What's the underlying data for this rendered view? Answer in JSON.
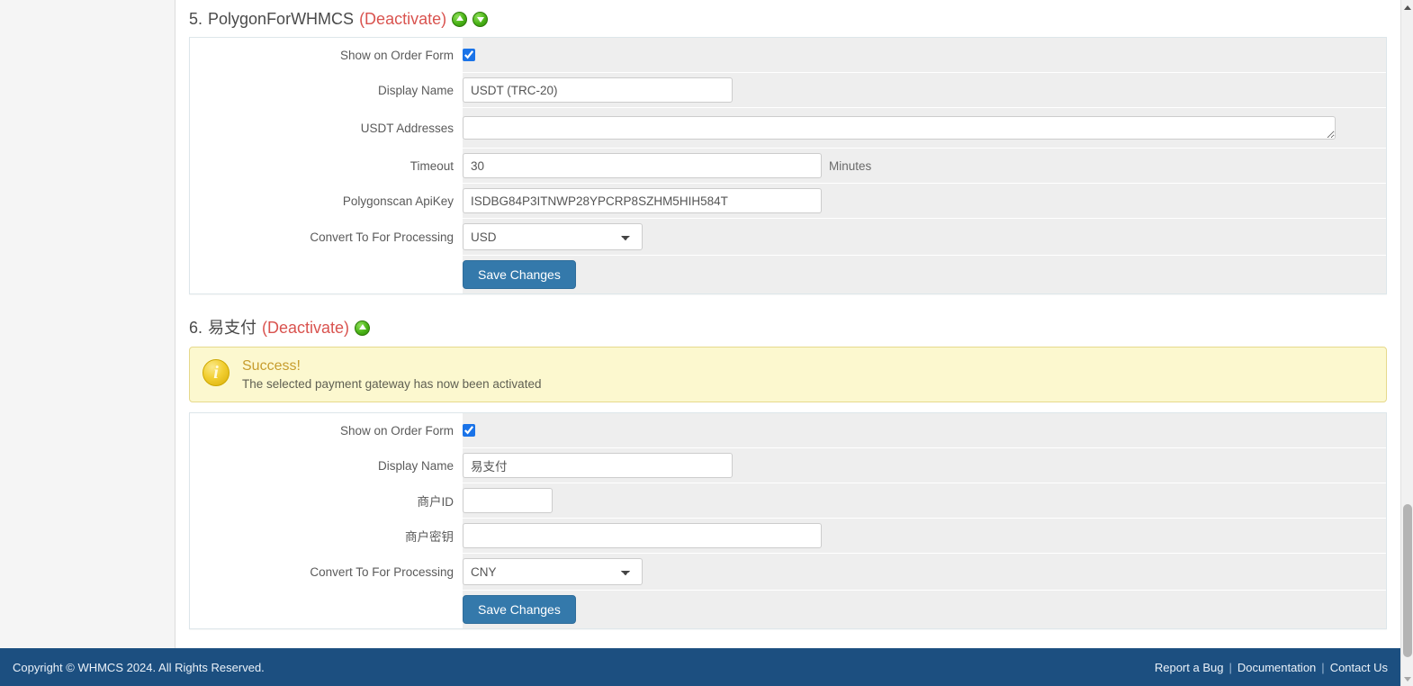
{
  "gateways": [
    {
      "index": "5.",
      "name": "PolygonForWHMCS",
      "deactivate_label": "(Deactivate)",
      "move_up_icon": "arrow-up-circle-icon",
      "move_down_icon": "arrow-down-circle-icon",
      "has_move_down": true,
      "fields": {
        "show_on_order_form_label": "Show on Order Form",
        "show_on_order_form_checked": true,
        "display_name_label": "Display Name",
        "display_name_value": "USDT (TRC-20)",
        "usdt_addresses_label": "USDT Addresses",
        "usdt_addresses_value": "",
        "timeout_label": "Timeout",
        "timeout_value": "30",
        "timeout_suffix": "Minutes",
        "apikey_label": "Polygonscan ApiKey",
        "apikey_value": "ISDBG84P3ITNWP28YPCRP8SZHM5HIH584T",
        "convert_label": "Convert To For Processing",
        "convert_value": "USD",
        "convert_options": [
          "USD"
        ],
        "save_label": "Save Changes"
      }
    },
    {
      "index": "6.",
      "name": "易支付",
      "deactivate_label": "(Deactivate)",
      "move_up_icon": "arrow-up-circle-icon",
      "has_move_down": false,
      "alert": {
        "icon": "info-circle-icon",
        "title": "Success!",
        "message": "The selected payment gateway has now been activated"
      },
      "fields": {
        "show_on_order_form_label": "Show on Order Form",
        "show_on_order_form_checked": true,
        "display_name_label": "Display Name",
        "display_name_value": "易支付",
        "merchant_id_label": "商户ID",
        "merchant_id_value": "",
        "merchant_key_label": "商户密钥",
        "merchant_key_value": "",
        "convert_label": "Convert To For Processing",
        "convert_value": "CNY",
        "convert_options": [
          "CNY"
        ],
        "save_label": "Save Changes"
      }
    }
  ],
  "footer": {
    "copyright": "Copyright © WHMCS 2024. All Rights Reserved.",
    "report_bug": "Report a Bug",
    "separator1": "|",
    "documentation": "Documentation",
    "separator2": "|",
    "contact_us": "Contact Us"
  },
  "colors": {
    "accent_blue": "#3479ab",
    "footer_blue": "#1c4f80",
    "deactivate_red": "#d9534f",
    "alert_yellow_bg": "#fcf8cf",
    "alert_yellow_border": "#e6d98c",
    "alert_title": "#c79d2e",
    "row_bg": "#eeeeee",
    "icon_green": "#49b216"
  }
}
